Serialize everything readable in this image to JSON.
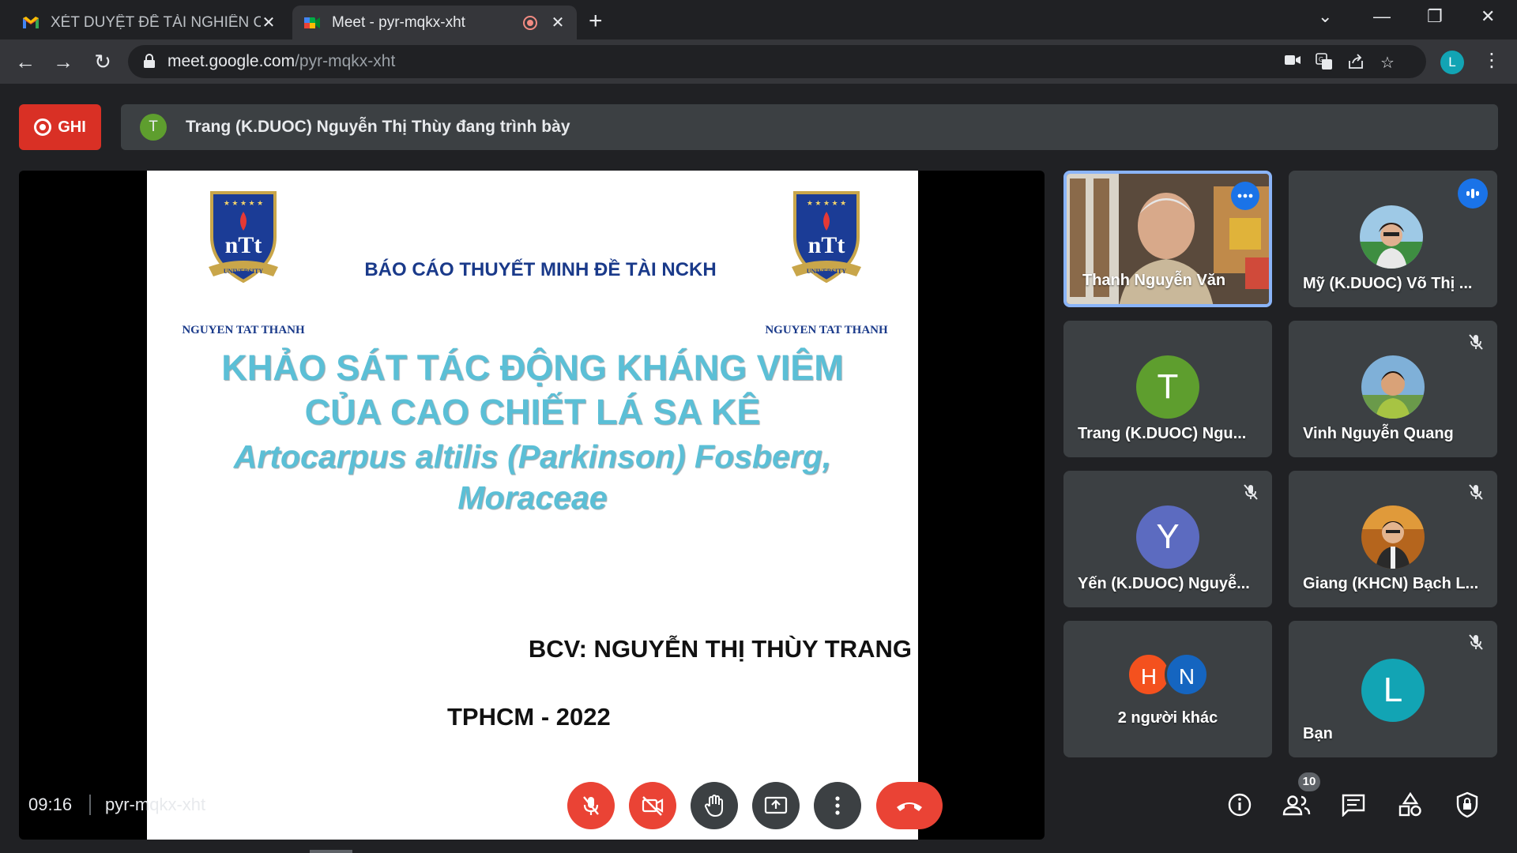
{
  "browser": {
    "tabs": [
      {
        "title": "XÉT DUYỆT ĐỀ TÀI NGHIÊN CỨU",
        "icon": "gmail-icon"
      },
      {
        "title": "Meet - pyr-mqkx-xht",
        "icon": "meet-icon",
        "active": true
      }
    ],
    "url_host": "meet.google.com",
    "url_path": "/pyr-mqkx-xht",
    "profile_initial": "L"
  },
  "meet": {
    "recording_label": "GHI",
    "presenter_initial": "T",
    "presenter_text": "Trang (K.DUOC) Nguyễn Thị Thùy đang trình bày",
    "slide": {
      "logo_caption": "NGUYEN TAT THANH",
      "logo_letters": "nTt",
      "logo_ribbon": "UNIVERSITY",
      "header": "BÁO CÁO THUYẾT MINH ĐỀ TÀI NCKH",
      "title_line1": "KHẢO SÁT TÁC ĐỘNG KHÁNG VIÊM",
      "title_line2": "CỦA CAO CHIẾT LÁ SA KÊ",
      "sci_line1": "Artocarpus altilis (Parkinson) Fosberg,",
      "sci_line2": "Moraceae",
      "author": "BCV: NGUYỄN THỊ THÙY TRANG",
      "footer": "TPHCM - 2022"
    },
    "participants": [
      {
        "name": "Thanh Nguyễn Văn",
        "type": "video"
      },
      {
        "name": "Mỹ (K.DUOC) Võ Thị ...",
        "type": "photo",
        "speaking": true
      },
      {
        "name": "Trang (K.DUOC) Ngu...",
        "initial": "T",
        "color": "#5e9e2e"
      },
      {
        "name": "Vinh Nguyễn Quang",
        "type": "photo",
        "muted": true
      },
      {
        "name": "Yến (K.DUOC) Nguyễ...",
        "initial": "Y",
        "color": "#5c6bc0",
        "muted": true
      },
      {
        "name": "Giang (KHCN) Bạch L...",
        "type": "photo",
        "muted": true
      },
      {
        "name": "2 người khác",
        "initials": [
          "H",
          "N"
        ],
        "colors": [
          "#f4511e",
          "#1565c0"
        ]
      },
      {
        "name": "Bạn",
        "initial": "L",
        "color": "#12a4b4",
        "muted": true
      }
    ],
    "time": "09:16",
    "meeting_code": "pyr-mqkx-xht",
    "participant_count": "10"
  },
  "colors": {
    "accent_red": "#ea4335",
    "accent_blue": "#1a73e8",
    "slide_title": "#5bbfd6",
    "slide_header": "#1a3a8a"
  }
}
